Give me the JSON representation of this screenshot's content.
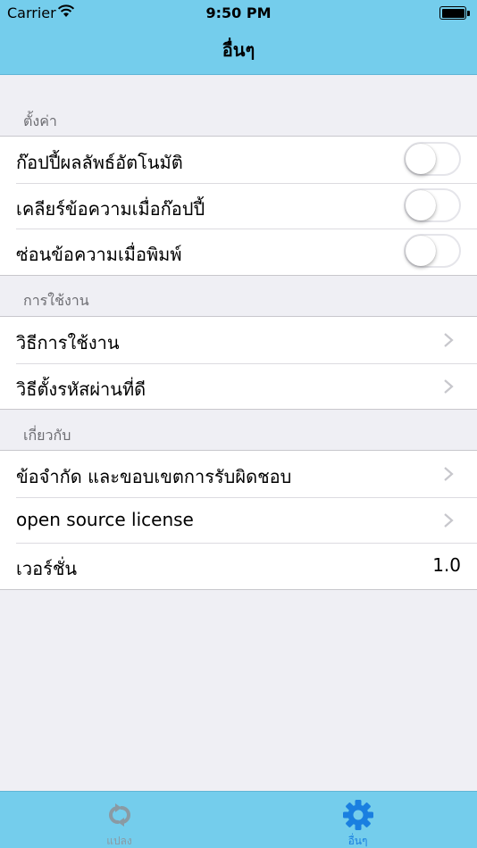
{
  "status_bar": {
    "carrier": "Carrier",
    "time": "9:50 PM",
    "wifi_icon": "wifi-icon",
    "battery_icon": "battery-icon"
  },
  "nav": {
    "title": "อื่นๆ"
  },
  "sections": {
    "settings": {
      "header": "ตั้งค่า",
      "items": [
        {
          "label": "ก๊อปปี้ผลลัพธ์อัตโนมัติ",
          "toggle_on": false
        },
        {
          "label": "เคลียร์ข้อความเมื่อก๊อปปี้",
          "toggle_on": false
        },
        {
          "label": "ซ่อนข้อความเมื่อพิมพ์",
          "toggle_on": false
        }
      ]
    },
    "usage": {
      "header": "การใช้งาน",
      "items": [
        {
          "label": "วิธีการใช้งาน"
        },
        {
          "label": "วิธีตั้งรหัสผ่านที่ดี"
        }
      ]
    },
    "about": {
      "header": "เกี่ยวกับ",
      "items": [
        {
          "label": "ข้อจำกัด และขอบเขตการรับผิดชอบ"
        },
        {
          "label": "open source license"
        },
        {
          "label": "เวอร์ชั่น",
          "value": "1.0"
        }
      ]
    }
  },
  "tabbar": {
    "tabs": [
      {
        "label": "แปลง",
        "icon": "convert-icon",
        "selected": false
      },
      {
        "label": "อื่นๆ",
        "icon": "gear-icon",
        "selected": true
      }
    ]
  },
  "colors": {
    "bar_background": "#74cdec",
    "group_background": "#efeff4",
    "tab_selected": "#1a7fe0",
    "tab_unselected": "#8a9aa3",
    "chevron": "#c7c7cc"
  }
}
